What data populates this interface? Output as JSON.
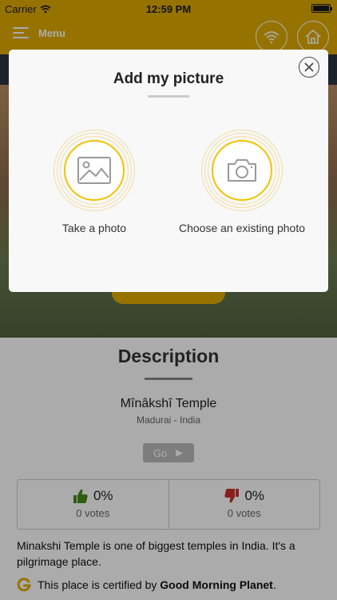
{
  "status_bar": {
    "carrier": "Carrier",
    "time": "12:59 PM"
  },
  "nav": {
    "menu_label": "Menu"
  },
  "content": {
    "section_title": "Description",
    "place_name": "Mînâkshî Temple",
    "place_location": "Madurai - India",
    "go_label": "Go",
    "votes_up": {
      "percent": "0%",
      "count": "0 votes"
    },
    "votes_down": {
      "percent": "0%",
      "count": "0 votes"
    },
    "about": "Minakshi Temple is one of biggest temples in India. It's a pilgrimage place.",
    "cert_prefix": "This place is certified by ",
    "cert_brand": "Good Morning Planet",
    "cert_suffix": "."
  },
  "modal": {
    "title": "Add my picture",
    "option_photo": "Take a photo",
    "option_existing": "Choose an existing photo"
  },
  "colors": {
    "brand_yellow": "#e0ac00",
    "thumb_up": "#4a8a1c",
    "thumb_down": "#cc2e2e",
    "ring_accent": "#f2c200"
  },
  "icons": {
    "wifi": "wifi-icon",
    "home": "home-icon",
    "image": "image-icon",
    "camera": "camera-icon",
    "close": "close-icon"
  }
}
